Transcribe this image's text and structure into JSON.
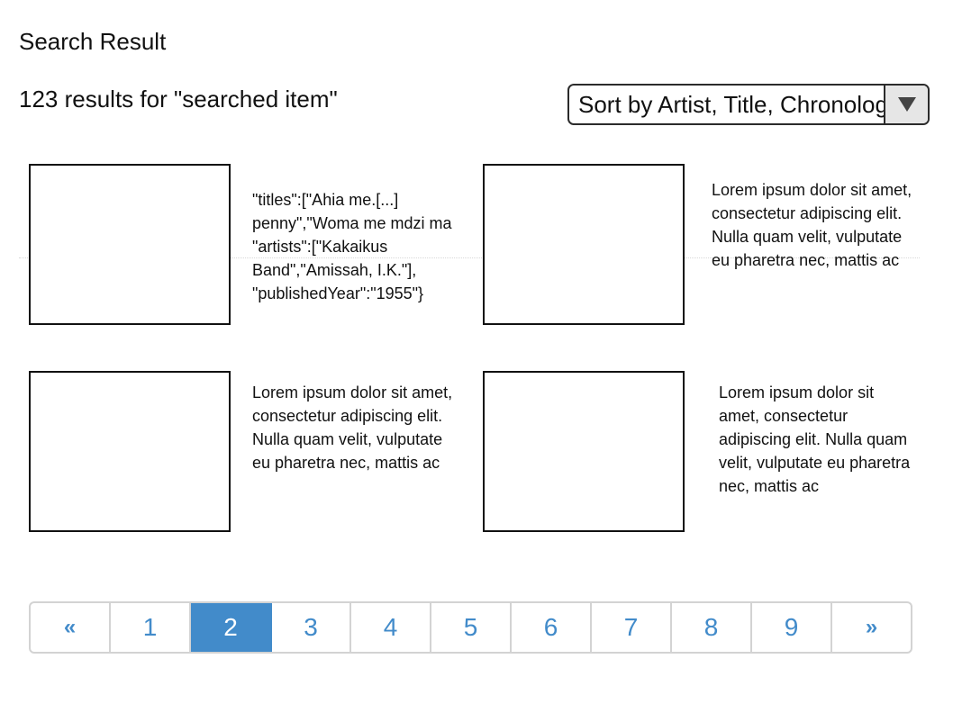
{
  "header": {
    "title": "Search Result",
    "result_count": "123 results for \"searched item\""
  },
  "sort": {
    "selected": "Sort by Artist, Title, Chronological",
    "icon": "triangle-down-icon"
  },
  "results": [
    {
      "description": "\"titles\":[\"Ahia me.[...] penny\",\"Woma me mdzi ma \"artists\":[\"Kakaikus Band\",\"Amissah, I.K.\"], \"publishedYear\":\"1955\"}"
    },
    {
      "description": "Lorem ipsum dolor sit amet, consectetur adipiscing elit. Nulla quam velit, vulputate eu pharetra nec, mattis ac"
    },
    {
      "description": "Lorem ipsum dolor sit amet, consectetur adipiscing elit. Nulla quam velit, vulputate eu pharetra nec, mattis ac"
    },
    {
      "description": "Lorem ipsum dolor sit amet, consectetur adipiscing elit. Nulla quam velit, vulputate eu pharetra nec, mattis ac"
    }
  ],
  "pagination": {
    "prev": "«",
    "pages": [
      "1",
      "2",
      "3",
      "4",
      "5",
      "6",
      "7",
      "8",
      "9"
    ],
    "current": "2",
    "next": "»"
  },
  "colors": {
    "accent": "#428bca",
    "border": "#d3d3d3"
  }
}
